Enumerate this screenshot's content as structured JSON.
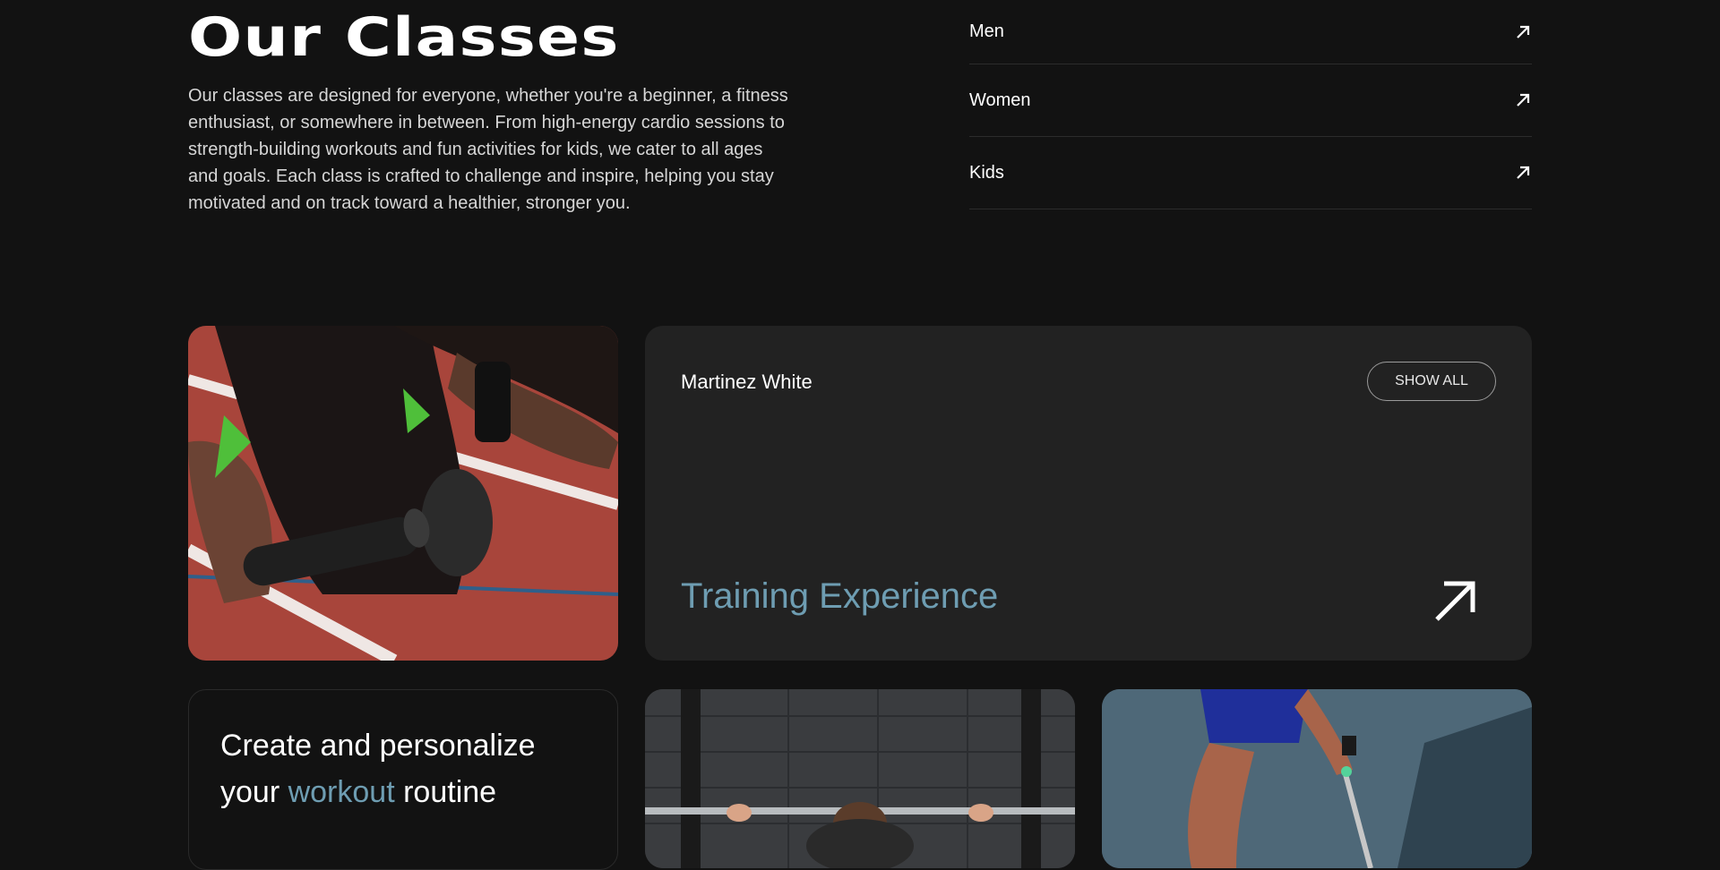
{
  "header": {
    "title": "Our Classes",
    "description": "Our classes are designed for everyone, whether you're a beginner, a fitness enthusiast, or somewhere in between. From high-energy cardio sessions to strength-building workouts and fun activities for kids, we cater to all ages and goals. Each class is crafted to challenge and inspire, helping you stay motivated and on track toward a healthier, stronger you."
  },
  "categories": [
    {
      "label": "Men",
      "icon": "arrow-up-right-icon"
    },
    {
      "label": "Women",
      "icon": "arrow-up-right-icon"
    },
    {
      "label": "Kids",
      "icon": "arrow-up-right-icon"
    }
  ],
  "trainer_card": {
    "name": "Martinez White",
    "show_all_label": "SHOW ALL",
    "title": "Training Experience",
    "icon": "arrow-up-right-icon"
  },
  "workout_card": {
    "title_part1": "Create and personalize your ",
    "title_accent": "workout",
    "title_part2": " routine"
  },
  "colors": {
    "background": "#121212",
    "card": "#222222",
    "accent": "#6e9db2",
    "text": "#ffffff"
  }
}
